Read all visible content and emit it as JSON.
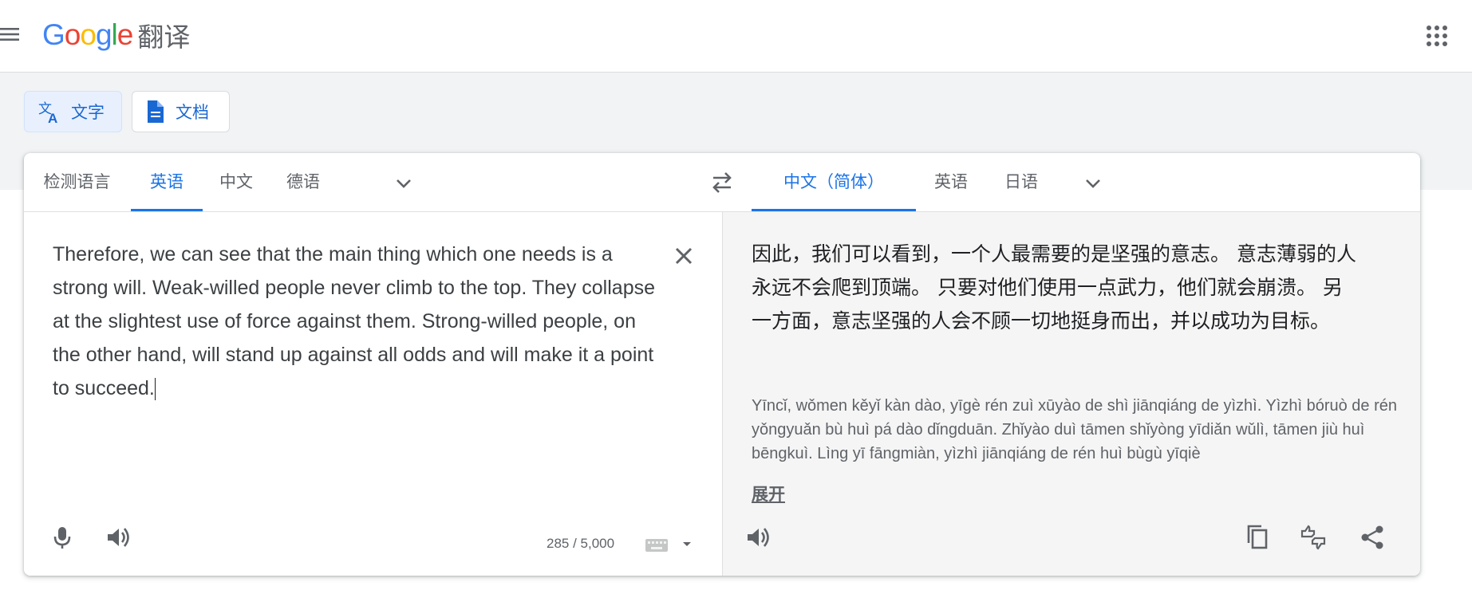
{
  "header": {
    "menu_icon": "hamburger-menu-icon",
    "logo": {
      "letters": [
        "G",
        "o",
        "o",
        "g",
        "l",
        "e"
      ],
      "letter_colors": [
        "#4285F4",
        "#EA4335",
        "#FBBC05",
        "#4285F4",
        "#34A853",
        "#EA4335"
      ],
      "product": "翻译"
    },
    "apps_icon": "apps-grid-icon"
  },
  "modes": [
    {
      "label": "文字",
      "icon": "translate-icon",
      "active": true
    },
    {
      "label": "文档",
      "icon": "document-icon",
      "active": false
    }
  ],
  "source": {
    "tabs": [
      "检测语言",
      "英语",
      "中文",
      "德语"
    ],
    "active_tab": 1,
    "text": "Therefore, we can see that the main thing which one needs is a strong will. Weak-willed people never climb to the top. They collapse at the slightest use of force against them. Strong-willed people, on the other hand, will stand up against all odds and will make it a point to succeed.",
    "char_count": "285 / 5,000",
    "clear_icon": "close-icon",
    "mic_icon": "microphone-icon",
    "listen_icon": "speaker-icon",
    "keyboard_icon": "keyboard-icon"
  },
  "target": {
    "tabs": [
      "中文（简体）",
      "英语",
      "日语"
    ],
    "active_tab": 0,
    "text": "因此，我们可以看到，一个人最需要的是坚强的意志。 意志薄弱的人永远不会爬到顶端。 只要对他们使用一点武力，他们就会崩溃。 另一方面，意志坚强的人会不顾一切地挺身而出，并以成功为目标。",
    "transliteration": "Yīncǐ, wǒmen kěyǐ kàn dào, yīgè rén zuì xūyào de shì jiānqiáng de yìzhì. Yìzhì bóruò de rén yǒngyuǎn bù huì pá dào dǐngduān. Zhǐyào duì tāmen shǐyòng yīdiǎn wǔlì, tāmen jiù huì bēngkuì. Lìng yī fāngmiàn, yìzhì jiānqiáng de rén huì bùgù yīqiè",
    "expand_label": "展开",
    "icons": [
      "speaker-icon",
      "copy-icon",
      "rate-translation-icon",
      "share-icon"
    ]
  },
  "colors": {
    "accent": "#1a73e8",
    "active_mode_bg": "#e8f0fe",
    "target_pane_bg": "#f5f5f5",
    "band_bg": "#f1f3f4"
  }
}
